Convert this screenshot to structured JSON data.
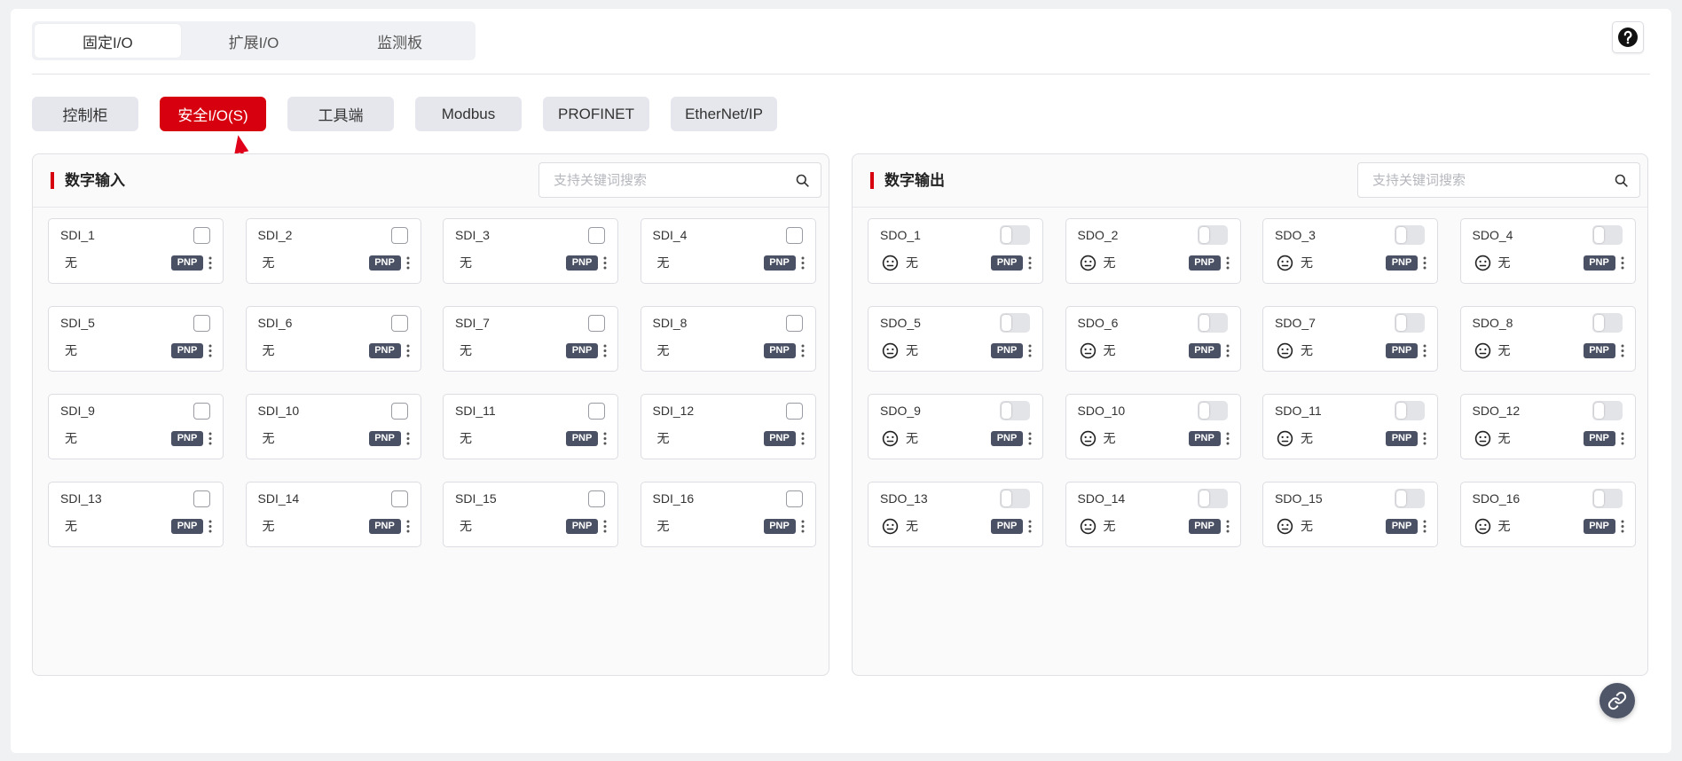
{
  "top_tabs": [
    {
      "label": "固定I/O",
      "active": true
    },
    {
      "label": "扩展I/O",
      "active": false
    },
    {
      "label": "监测板",
      "active": false
    }
  ],
  "help_button": {
    "icon": "question-icon"
  },
  "sub_tabs": [
    {
      "label": "控制柜",
      "active": false
    },
    {
      "label": "安全I/O(S)",
      "active": true
    },
    {
      "label": "工具端",
      "active": false
    },
    {
      "label": "Modbus",
      "active": false
    },
    {
      "label": "PROFINET",
      "active": false
    },
    {
      "label": "EtherNet/IP",
      "active": false
    }
  ],
  "annotation": {
    "icon": "red-arrow-icon",
    "color": "#e0001a"
  },
  "digital_input": {
    "title": "数字输入",
    "search_placeholder": "支持关键词搜索",
    "search_icon": "search-icon",
    "items": [
      {
        "name": "SDI_1",
        "value": "无",
        "mode": "PNP",
        "checked": false
      },
      {
        "name": "SDI_2",
        "value": "无",
        "mode": "PNP",
        "checked": false
      },
      {
        "name": "SDI_3",
        "value": "无",
        "mode": "PNP",
        "checked": false
      },
      {
        "name": "SDI_4",
        "value": "无",
        "mode": "PNP",
        "checked": false
      },
      {
        "name": "SDI_5",
        "value": "无",
        "mode": "PNP",
        "checked": false
      },
      {
        "name": "SDI_6",
        "value": "无",
        "mode": "PNP",
        "checked": false
      },
      {
        "name": "SDI_7",
        "value": "无",
        "mode": "PNP",
        "checked": false
      },
      {
        "name": "SDI_8",
        "value": "无",
        "mode": "PNP",
        "checked": false
      },
      {
        "name": "SDI_9",
        "value": "无",
        "mode": "PNP",
        "checked": false
      },
      {
        "name": "SDI_10",
        "value": "无",
        "mode": "PNP",
        "checked": false
      },
      {
        "name": "SDI_11",
        "value": "无",
        "mode": "PNP",
        "checked": false
      },
      {
        "name": "SDI_12",
        "value": "无",
        "mode": "PNP",
        "checked": false
      },
      {
        "name": "SDI_13",
        "value": "无",
        "mode": "PNP",
        "checked": false
      },
      {
        "name": "SDI_14",
        "value": "无",
        "mode": "PNP",
        "checked": false
      },
      {
        "name": "SDI_15",
        "value": "无",
        "mode": "PNP",
        "checked": false
      },
      {
        "name": "SDI_16",
        "value": "无",
        "mode": "PNP",
        "checked": false
      }
    ]
  },
  "digital_output": {
    "title": "数字输出",
    "search_placeholder": "支持关键词搜索",
    "search_icon": "search-icon",
    "items": [
      {
        "name": "SDO_1",
        "value": "无",
        "mode": "PNP",
        "on": false,
        "status_icon": "neutral-face-icon"
      },
      {
        "name": "SDO_2",
        "value": "无",
        "mode": "PNP",
        "on": false,
        "status_icon": "neutral-face-icon"
      },
      {
        "name": "SDO_3",
        "value": "无",
        "mode": "PNP",
        "on": false,
        "status_icon": "neutral-face-icon"
      },
      {
        "name": "SDO_4",
        "value": "无",
        "mode": "PNP",
        "on": false,
        "status_icon": "neutral-face-icon"
      },
      {
        "name": "SDO_5",
        "value": "无",
        "mode": "PNP",
        "on": false,
        "status_icon": "neutral-face-icon"
      },
      {
        "name": "SDO_6",
        "value": "无",
        "mode": "PNP",
        "on": false,
        "status_icon": "neutral-face-icon"
      },
      {
        "name": "SDO_7",
        "value": "无",
        "mode": "PNP",
        "on": false,
        "status_icon": "neutral-face-icon"
      },
      {
        "name": "SDO_8",
        "value": "无",
        "mode": "PNP",
        "on": false,
        "status_icon": "neutral-face-icon"
      },
      {
        "name": "SDO_9",
        "value": "无",
        "mode": "PNP",
        "on": false,
        "status_icon": "neutral-face-icon"
      },
      {
        "name": "SDO_10",
        "value": "无",
        "mode": "PNP",
        "on": false,
        "status_icon": "neutral-face-icon"
      },
      {
        "name": "SDO_11",
        "value": "无",
        "mode": "PNP",
        "on": false,
        "status_icon": "neutral-face-icon"
      },
      {
        "name": "SDO_12",
        "value": "无",
        "mode": "PNP",
        "on": false,
        "status_icon": "neutral-face-icon"
      },
      {
        "name": "SDO_13",
        "value": "无",
        "mode": "PNP",
        "on": false,
        "status_icon": "neutral-face-icon"
      },
      {
        "name": "SDO_14",
        "value": "无",
        "mode": "PNP",
        "on": false,
        "status_icon": "neutral-face-icon"
      },
      {
        "name": "SDO_15",
        "value": "无",
        "mode": "PNP",
        "on": false,
        "status_icon": "neutral-face-icon"
      },
      {
        "name": "SDO_16",
        "value": "无",
        "mode": "PNP",
        "on": false,
        "status_icon": "neutral-face-icon"
      }
    ]
  },
  "float_button": {
    "icon": "link-icon"
  },
  "colors": {
    "accent": "#d7000f",
    "badge": "#4a5164",
    "background": "#f0f1f3"
  }
}
